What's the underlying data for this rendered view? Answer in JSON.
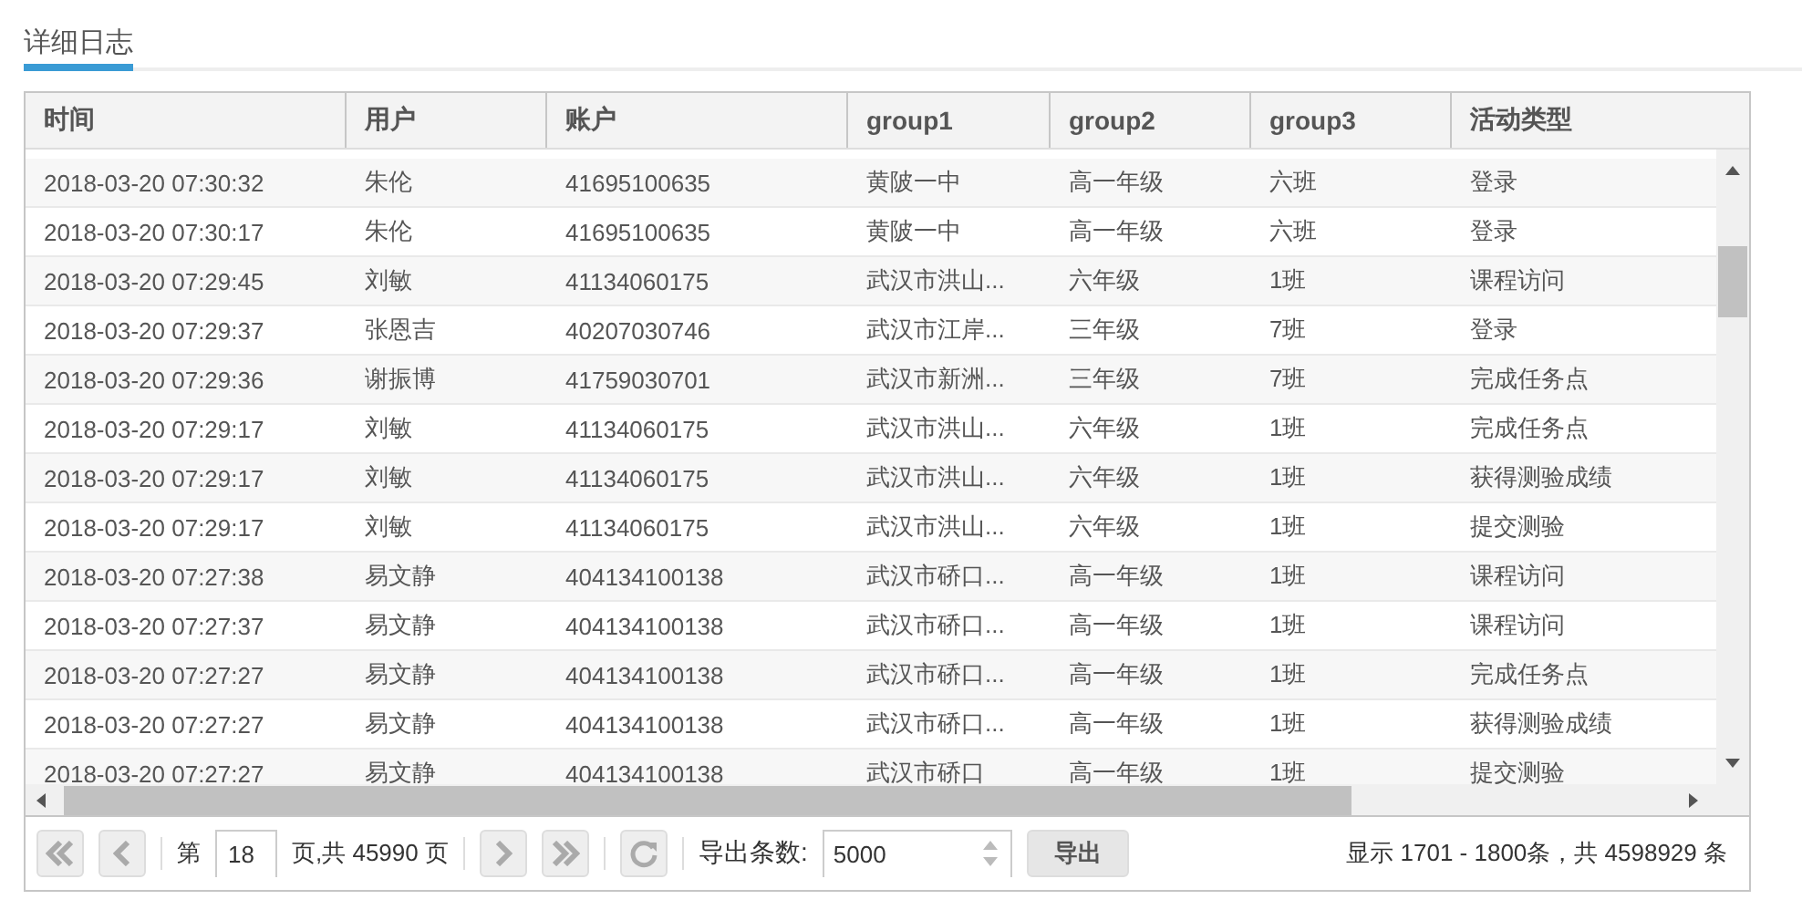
{
  "tab": {
    "label": "详细日志",
    "selected": true
  },
  "table": {
    "columns": [
      "时间",
      "用户",
      "账户",
      "group1",
      "group2",
      "group3",
      "活动类型"
    ],
    "rows": [
      [
        "2018-03-20 07:30:32",
        "朱伦",
        "41695100635",
        "黄陂一中",
        "高一年级",
        "六班",
        "登录"
      ],
      [
        "2018-03-20 07:30:17",
        "朱伦",
        "41695100635",
        "黄陂一中",
        "高一年级",
        "六班",
        "登录"
      ],
      [
        "2018-03-20 07:29:45",
        "刘敏",
        "41134060175",
        "武汉市洪山...",
        "六年级",
        "1班",
        "课程访问"
      ],
      [
        "2018-03-20 07:29:37",
        "张恩吉",
        "40207030746",
        "武汉市江岸...",
        "三年级",
        "7班",
        "登录"
      ],
      [
        "2018-03-20 07:29:36",
        "谢振博",
        "41759030701",
        "武汉市新洲...",
        "三年级",
        "7班",
        "完成任务点"
      ],
      [
        "2018-03-20 07:29:17",
        "刘敏",
        "41134060175",
        "武汉市洪山...",
        "六年级",
        "1班",
        "完成任务点"
      ],
      [
        "2018-03-20 07:29:17",
        "刘敏",
        "41134060175",
        "武汉市洪山...",
        "六年级",
        "1班",
        "获得测验成绩"
      ],
      [
        "2018-03-20 07:29:17",
        "刘敏",
        "41134060175",
        "武汉市洪山...",
        "六年级",
        "1班",
        "提交测验"
      ],
      [
        "2018-03-20 07:27:38",
        "易文静",
        "404134100138",
        "武汉市硚口...",
        "高一年级",
        "1班",
        "课程访问"
      ],
      [
        "2018-03-20 07:27:37",
        "易文静",
        "404134100138",
        "武汉市硚口...",
        "高一年级",
        "1班",
        "课程访问"
      ],
      [
        "2018-03-20 07:27:27",
        "易文静",
        "404134100138",
        "武汉市硚口...",
        "高一年级",
        "1班",
        "完成任务点"
      ],
      [
        "2018-03-20 07:27:27",
        "易文静",
        "404134100138",
        "武汉市硚口...",
        "高一年级",
        "1班",
        "获得测验成绩"
      ],
      [
        "2018-03-20 07:27:27",
        "易文静",
        "404134100138",
        "武汉市硚口",
        "高一年级",
        "1班",
        "提交测验"
      ]
    ]
  },
  "pager": {
    "page_prefix": "第",
    "page": "18",
    "page_suffix": "页,共 45990 页",
    "export_label": "导出条数:",
    "export_count": "5000",
    "export_button": "导出",
    "summary": "显示 1701 - 1800条，共 4598929 条"
  }
}
